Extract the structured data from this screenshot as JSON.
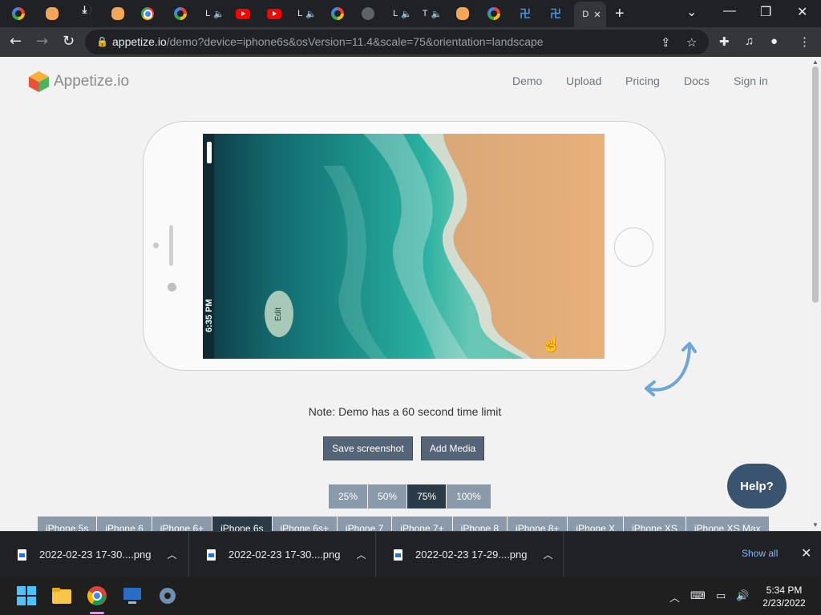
{
  "browser": {
    "tabs": [
      {
        "icon": "google-icon",
        "label": ""
      },
      {
        "icon": "coin-icon",
        "label": ""
      },
      {
        "icon": "download-icon",
        "label": ""
      },
      {
        "icon": "coin-icon",
        "label": ""
      },
      {
        "icon": "chrome-icon",
        "label": ""
      },
      {
        "icon": "google-icon",
        "label": ""
      },
      {
        "icon": "audio-icon",
        "label": "L"
      },
      {
        "icon": "youtube-icon",
        "label": ""
      },
      {
        "icon": "youtube-icon",
        "label": ""
      },
      {
        "icon": "audio-icon",
        "label": "L"
      },
      {
        "icon": "google-icon",
        "label": ""
      },
      {
        "icon": "globe-icon",
        "label": ""
      },
      {
        "icon": "audio-icon",
        "label": "L"
      },
      {
        "icon": "audio-icon",
        "label": "T"
      },
      {
        "icon": "coin-icon",
        "label": ""
      },
      {
        "icon": "google-icon",
        "label": ""
      },
      {
        "icon": "pf-icon",
        "label": ""
      },
      {
        "icon": "pf-icon",
        "label": ""
      },
      {
        "icon": "page-icon",
        "label": "D"
      }
    ],
    "url_host": "appetize.io",
    "url_path": "/demo?device=iphone6s&osVersion=11.4&scale=75&orientation=landscape"
  },
  "site": {
    "logo_text": "Appetize.io",
    "nav": [
      "Demo",
      "Upload",
      "Pricing",
      "Docs",
      "Sign in"
    ]
  },
  "device_screen": {
    "time": "6:35 PM",
    "edit_label": "Edit"
  },
  "note": "Note: Demo has a 60 second time limit",
  "buttons": {
    "save_screenshot": "Save screenshot",
    "add_media": "Add Media"
  },
  "scales": [
    "25%",
    "50%",
    "75%",
    "100%"
  ],
  "selected_scale": "75%",
  "devices": [
    "iPhone 5s",
    "iPhone 6",
    "iPhone 6+",
    "iPhone 6s",
    "iPhone 6s+",
    "iPhone 7",
    "iPhone 7+",
    "iPhone 8",
    "iPhone 8+",
    "iPhone X",
    "iPhone XS",
    "iPhone XS Max"
  ],
  "selected_device": "iPhone 6s",
  "help_label": "Help?",
  "downloads": {
    "items": [
      "2022-02-23 17-30....png",
      "2022-02-23 17-30....png",
      "2022-02-23 17-29....png"
    ],
    "show_all": "Show all"
  },
  "taskbar": {
    "time": "5:34 PM",
    "date": "2/23/2022"
  },
  "colors": {
    "accent_dark": "#2b3a47",
    "button": "#556577",
    "button_light": "#8a9aab",
    "help": "#3a5470"
  }
}
